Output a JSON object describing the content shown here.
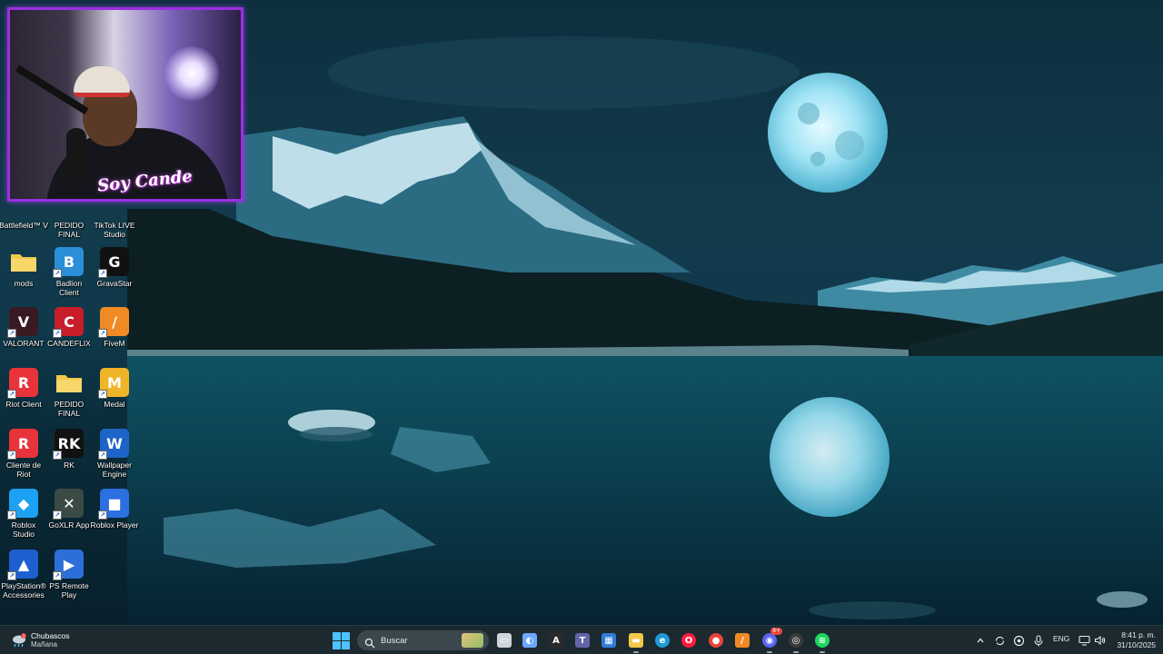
{
  "webcam": {
    "overlay_text": "Soy Cande"
  },
  "desktop_icons": [
    {
      "label": "Battlefield™ V",
      "icon": "battlefield-icon",
      "color": "#d8a341"
    },
    {
      "label": "PEDIDO\nFINAL",
      "icon": "folder-icon",
      "color": "#f2c84b"
    },
    {
      "label": "TikTok LIVE\nStudio",
      "icon": "tiktok-live-icon",
      "color": "#111111"
    },
    {
      "label": "mods",
      "icon": "folder-icon",
      "color": "#f2c84b"
    },
    {
      "label": "Badlion\nClient",
      "icon": "badlion-icon",
      "color": "#2b8fd8"
    },
    {
      "label": "GravaStar",
      "icon": "gravastar-icon",
      "color": "#111111"
    },
    {
      "label": "VALORANT",
      "icon": "valorant-icon",
      "color": "#3a1a22"
    },
    {
      "label": "CANDEFLIX",
      "icon": "candeflix-icon",
      "color": "#c81e2a"
    },
    {
      "label": "FiveM",
      "icon": "fivem-icon",
      "color": "#f08a24"
    },
    {
      "label": "Riot Client",
      "icon": "riot-client-icon",
      "color": "#e8333a"
    },
    {
      "label": "PEDIDO\nFINAL",
      "icon": "folder-icon",
      "color": "#f2c84b"
    },
    {
      "label": "Medal",
      "icon": "medal-icon",
      "color": "#f0b429"
    },
    {
      "label": "Cliente de\nRiot",
      "icon": "riot-client-icon",
      "color": "#e8333a"
    },
    {
      "label": "RK",
      "icon": "rk-icon",
      "color": "#111111"
    },
    {
      "label": "Wallpaper\nEngine",
      "icon": "wallpaper-engine-icon",
      "color": "#1e63c8"
    },
    {
      "label": "Roblox\nStudio",
      "icon": "roblox-studio-icon",
      "color": "#1da1f2"
    },
    {
      "label": "GoXLR App",
      "icon": "goxlr-icon",
      "color": "#3a4a45"
    },
    {
      "label": "Roblox Player",
      "icon": "roblox-player-icon",
      "color": "#2b6fe0"
    },
    {
      "label": "PlayStation®\nAccessories",
      "icon": "playstation-accessories-icon",
      "color": "#1d5fcf"
    },
    {
      "label": "PS Remote\nPlay",
      "icon": "ps-remote-play-icon",
      "color": "#2d6fd8"
    }
  ],
  "taskbar": {
    "weather": {
      "title": "Chubascos",
      "subtitle": "Mañana",
      "badge": "1"
    },
    "search_placeholder": "Buscar",
    "apps": [
      {
        "name": "task-view",
        "color": "#cfd6da"
      },
      {
        "name": "copilot",
        "color": "#6aa8ff"
      },
      {
        "name": "app-a",
        "color": "#2a2a2a"
      },
      {
        "name": "teams",
        "color": "#6264a7"
      },
      {
        "name": "store",
        "color": "#2f7bd8"
      },
      {
        "name": "file-explorer",
        "color": "#f2c84b"
      },
      {
        "name": "edge",
        "color": "#1f9bd7"
      },
      {
        "name": "opera-gx",
        "color": "#ff1b3d"
      },
      {
        "name": "chrome",
        "color": "#e8453c"
      },
      {
        "name": "fivem",
        "color": "#f08a24"
      },
      {
        "name": "discord",
        "color": "#5865f2"
      },
      {
        "name": "obs",
        "color": "#3b3b3b"
      },
      {
        "name": "spotify",
        "color": "#1ed760"
      }
    ],
    "discord_badge": "9+",
    "language": "ENG",
    "time": "8:41 p. m.",
    "date": "31/10/2025"
  }
}
